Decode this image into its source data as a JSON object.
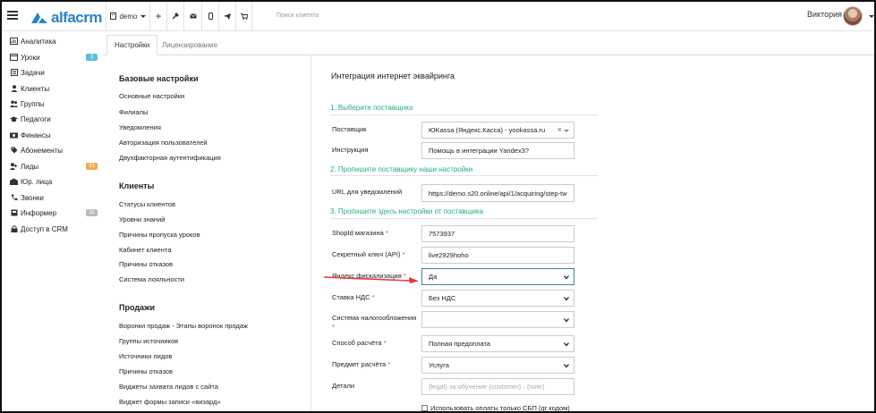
{
  "app": {
    "logo_text": "alfacrm",
    "brand_color": "#2a82c8"
  },
  "topbar": {
    "branch": "demo",
    "tools": [
      "plus-icon",
      "wrench-icon",
      "mail-icon",
      "phone-icon",
      "send-icon",
      "cart-icon"
    ],
    "search_placeholder": "Поиск клиента",
    "user_name": "Виктория"
  },
  "sidebar": {
    "items": [
      {
        "label": "Аналитика",
        "icon": "chart-icon"
      },
      {
        "label": "Уроки",
        "icon": "calendar-icon",
        "badge": "3",
        "badge_color": "#5bc0de"
      },
      {
        "label": "Задачи",
        "icon": "tasks-icon"
      },
      {
        "label": "Клиенты",
        "icon": "user-icon"
      },
      {
        "label": "Группы",
        "icon": "users-icon"
      },
      {
        "label": "Педагоги",
        "icon": "graduation-cap-icon"
      },
      {
        "label": "Финансы",
        "icon": "money-icon"
      },
      {
        "label": "Абонементы",
        "icon": "tag-icon"
      },
      {
        "label": "Лиды",
        "icon": "user-plus-icon",
        "badge": "31",
        "badge_color": "#f0ad4e"
      },
      {
        "label": "Юр. лица",
        "icon": "building-icon"
      },
      {
        "label": "Звонки",
        "icon": "phone-icon"
      },
      {
        "label": "Информер",
        "icon": "inbox-icon",
        "badge": "11",
        "badge_color": "#bbbbbb"
      },
      {
        "label": "Доступ в CRM",
        "icon": "lock-icon"
      }
    ]
  },
  "tabs": [
    {
      "label": "Настройки",
      "active": true
    },
    {
      "label": "Лицензирование",
      "active": false
    }
  ],
  "settings_menu": {
    "sections": [
      {
        "title": "Базовые настройки",
        "links": [
          "Основные настройки",
          "Филиалы",
          "Уведомления",
          "Авторизация пользователей",
          "Двухфакторная аутентификация"
        ]
      },
      {
        "title": "Клиенты",
        "links": [
          "Статусы клиентов",
          "Уровни знаний",
          "Причины пропуска уроков",
          "Кабинет клиента",
          "Причины отказов",
          "Система лояльности"
        ]
      },
      {
        "title": "Продажи",
        "links": [
          "Воронки продаж - Этапы воронок продаж",
          "Группы источников",
          "Источники лидов",
          "Причины отказов",
          "Виджеты захвата лидов с сайта",
          "Виджет формы записи «визард»"
        ]
      }
    ]
  },
  "panel": {
    "title": "Интеграция интернет эквайринга",
    "steps": [
      "1. Выберите поставщика",
      "2. Пропишите поставщику наши настройки",
      "3. Пропишите здесь настройки от поставщика"
    ],
    "fields": {
      "provider": {
        "label": "Поставщик",
        "value": "ЮKassa (Яндекс.Касса) - yookassa.ru"
      },
      "instruction": {
        "label": "Инструкция",
        "value": "Помощь в интеграции Yandex3?"
      },
      "notify_url": {
        "label": "URL для уведомлений",
        "value": "https://demo.s20.online/api/1/acquiring/step-tw"
      },
      "shop_id": {
        "label": "ShopId магазина",
        "value": "7573937"
      },
      "secret_key": {
        "label": "Секретный ключ (API)",
        "value": "live2929hoho"
      },
      "fiscal": {
        "label": "Яндекс фискализация",
        "value": "Да"
      },
      "vat": {
        "label": "Ставка НДС",
        "value": "Без НДС"
      },
      "tax_system": {
        "label": "Система налогообложения",
        "value": ""
      },
      "payment_method": {
        "label": "Способ расчёта",
        "value": "Полная предоплата"
      },
      "payment_subject": {
        "label": "Предмет расчёта",
        "value": "Услуга"
      },
      "details": {
        "label": "Детали",
        "placeholder": "{legal} за обучение {customer} - {note}"
      }
    },
    "sbp_checkbox_label": "Использовать оплаты только СБП (qr кодом)",
    "accent_color": "#2aa88f",
    "arrow_color": "#e53935"
  }
}
